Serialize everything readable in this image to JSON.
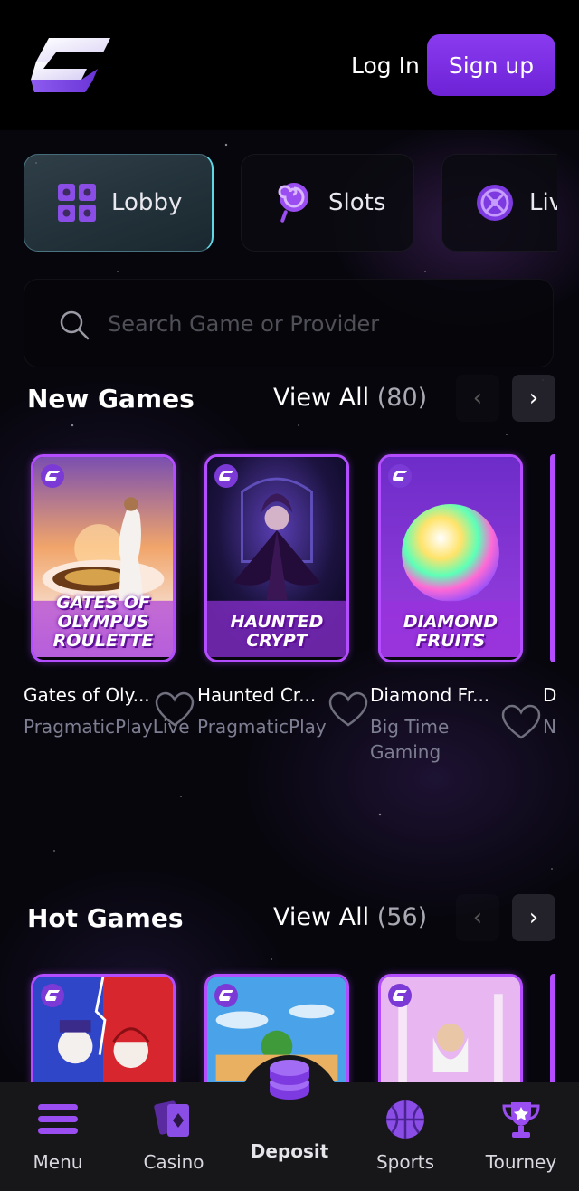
{
  "header": {
    "login_label": "Log In",
    "signup_label": "Sign up"
  },
  "categories": [
    {
      "label": "Lobby",
      "icon": "lobby-icon",
      "active": true
    },
    {
      "label": "Slots",
      "icon": "lollipop-icon",
      "active": false
    },
    {
      "label": "Liv",
      "icon": "roulette-icon",
      "active": false
    }
  ],
  "search": {
    "placeholder": "Search Game or Provider"
  },
  "new_games": {
    "title": "New Games",
    "view_all": "View All",
    "count": "(80)",
    "games": [
      {
        "name": "Gates of Oly...",
        "provider": "PragmaticPlayLive",
        "art_title": "GATES OF OLYMPUS ROULETTE"
      },
      {
        "name": "Haunted Cr...",
        "provider": "PragmaticPlay",
        "art_title": "HAUNTED CRYPT"
      },
      {
        "name": "Diamond Fr...",
        "provider": "Big Time Gaming",
        "art_title": "DIAMOND FRUITS"
      },
      {
        "name": "D",
        "provider": "N"
      }
    ]
  },
  "hot_games": {
    "title": "Hot Games",
    "view_all": "View All",
    "count": "(56)"
  },
  "nav": [
    {
      "label": "Menu",
      "icon": "hamburger-icon"
    },
    {
      "label": "Casino",
      "icon": "cards-icon"
    },
    {
      "label": "Deposit",
      "icon": "coins-stack-icon"
    },
    {
      "label": "Sports",
      "icon": "basketball-icon"
    },
    {
      "label": "Tourney",
      "icon": "trophy-icon"
    }
  ],
  "colors": {
    "accent": "#7b2ff0",
    "card_border": "#b44dff",
    "background": "#07060d",
    "nav_bg": "#171619"
  }
}
